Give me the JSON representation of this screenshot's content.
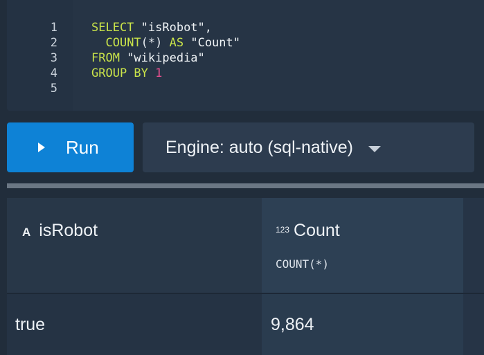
{
  "editor": {
    "line_numbers": [
      "1",
      "2",
      "3",
      "4",
      "5"
    ],
    "lines": [
      [
        {
          "t": "SELECT ",
          "c": "kw"
        },
        {
          "t": "\"isRobot\"",
          "c": "str"
        },
        {
          "t": ",",
          "c": "punct"
        }
      ],
      [
        {
          "t": "  ",
          "c": "punct"
        },
        {
          "t": "COUNT",
          "c": "fn"
        },
        {
          "t": "(*) ",
          "c": "punct"
        },
        {
          "t": "AS ",
          "c": "kw"
        },
        {
          "t": "\"Count\"",
          "c": "str"
        }
      ],
      [
        {
          "t": "FROM ",
          "c": "kw"
        },
        {
          "t": "\"wikipedia\"",
          "c": "str"
        }
      ],
      [
        {
          "t": "GROUP BY ",
          "c": "kw"
        },
        {
          "t": "1",
          "c": "num"
        }
      ],
      []
    ]
  },
  "toolbar": {
    "run_label": "Run",
    "engine_label": "Engine: auto (sql-native)"
  },
  "results": {
    "columns": [
      {
        "type_icon": "A",
        "name": "isRobot",
        "expression": ""
      },
      {
        "type_icon": "123",
        "name": "Count",
        "expression": "COUNT(*)"
      }
    ],
    "rows": [
      [
        "true",
        "9,864"
      ]
    ]
  },
  "colors": {
    "run_button": "#0e82d6",
    "keyword": "#c9e34a",
    "number_literal": "#e64f8f",
    "background": "#212d3b"
  }
}
